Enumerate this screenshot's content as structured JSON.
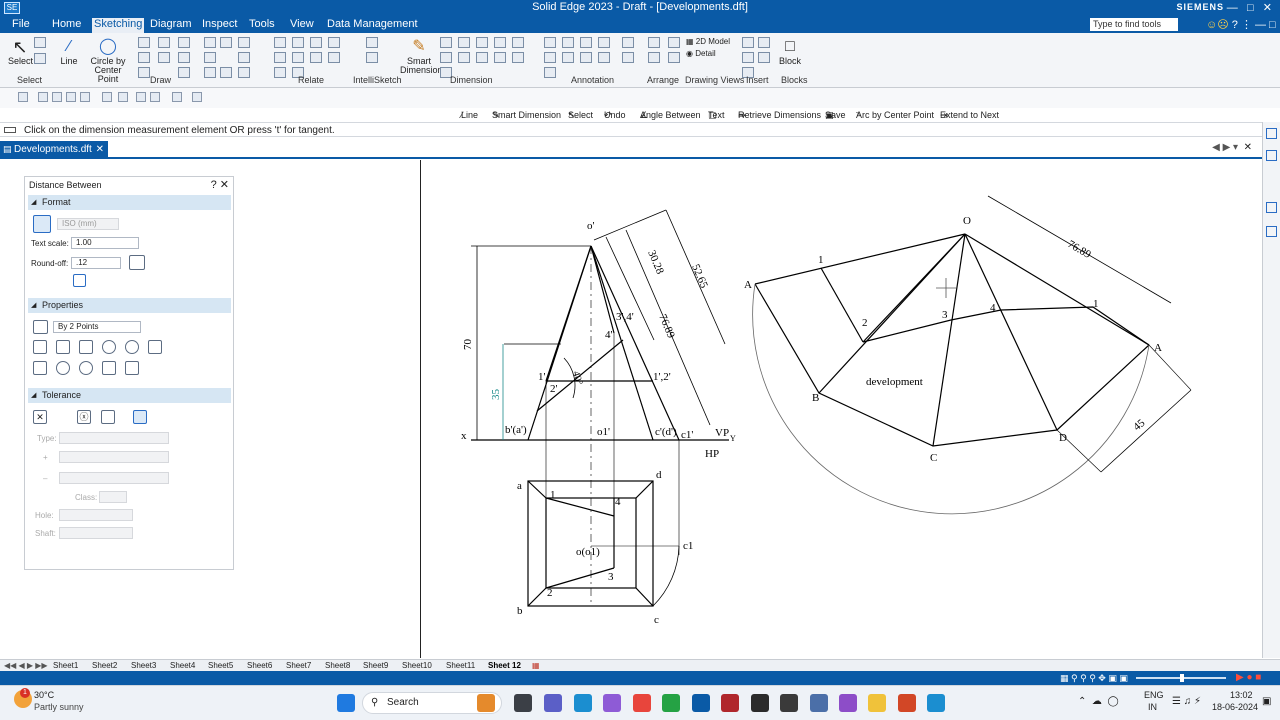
{
  "window": {
    "title": "Solid Edge 2023 - Draft - [Developments.dft]",
    "brand": "SIEMENS",
    "logo": "SE"
  },
  "menu": {
    "items": [
      "File",
      "Home",
      "Sketching",
      "Diagram",
      "Inspect",
      "Tools",
      "View",
      "Data Management"
    ],
    "active": "Sketching",
    "search_placeholder": "Type to find tools"
  },
  "ribbon": {
    "select": "Select",
    "line": "Line",
    "circle": "Circle by Center Point",
    "smart_dimension": "Smart Dimension",
    "model_2d": "2D Model",
    "detail": "Detail",
    "block": "Block",
    "groups": [
      "Select",
      "Draw",
      "Relate",
      "IntelliSketch",
      "Dimension",
      "Annotation",
      "Arrange",
      "Drawing Views",
      "Insert",
      "Blocks"
    ]
  },
  "command_bar": [
    "Line",
    "Smart Dimension",
    "Select",
    "Undo",
    "Angle Between",
    "Text",
    "Retrieve Dimensions",
    "Save",
    "Arc by Center Point",
    "Extend to Next"
  ],
  "prompt": "Click on the dimension measurement element  OR press 't' for tangent.",
  "document_tab": "Developments.dft",
  "panel": {
    "title": "Distance Between",
    "help": "?",
    "format": {
      "heading": "Format",
      "standard": "ISO (mm)",
      "text_scale_label": "Text scale:",
      "text_scale": "1.00",
      "roundoff_label": "Round-off:",
      "roundoff": ".12"
    },
    "properties": {
      "heading": "Properties",
      "mode": "By 2 Points"
    },
    "tolerance": {
      "heading": "Tolerance",
      "type_label": "Type:",
      "plus": "+",
      "minus": "–",
      "class_label": "Class:",
      "hole_label": "Hole:",
      "shaft_label": "Shaft:"
    }
  },
  "drawing": {
    "labels": {
      "o_prime": "o'",
      "dim_70": "70",
      "dim_35": "35",
      "dim_3028": "30.28",
      "dim_5265": "52.65",
      "dim_7689_a": "76.89",
      "p34": "3',4'",
      "p4": "4'",
      "p1": "1'",
      "p2": "2'",
      "angle": "40°",
      "p12": "1',2'",
      "x": "x",
      "ba": "b'(a')",
      "o1": "o1'",
      "cd": "c'(d')",
      "c1p": "c1'",
      "vp": "VP",
      "y": "Y",
      "hp": "HP",
      "a": "a",
      "b": "b",
      "c": "c",
      "d": "d",
      "t1": "1",
      "t2": "2",
      "t3": "3",
      "t4": "4",
      "oo1": "o(o1)",
      "c1": "c1",
      "O": "O",
      "dim_7689": "76.89",
      "A1": "A",
      "A2": "A",
      "B": "B",
      "C": "C",
      "D": "D",
      "d1a": "1",
      "d2": "2",
      "d3": "3",
      "d4": "4",
      "d1b": "1",
      "development": "development",
      "dim_45": "45"
    }
  },
  "sheets": [
    "Sheet1",
    "Sheet2",
    "Sheet3",
    "Sheet4",
    "Sheet5",
    "Sheet6",
    "Sheet7",
    "Sheet8",
    "Sheet9",
    "Sheet10",
    "Sheet11",
    "Sheet 12"
  ],
  "active_sheet": "Sheet 12",
  "taskbar": {
    "temp": "30°C",
    "weather": "Partly sunny",
    "search": "Search",
    "lang1": "ENG",
    "lang2": "IN",
    "time": "13:02",
    "date": "18-06-2024",
    "badge": "1"
  },
  "colors": {
    "accent": "#0a5aa6",
    "dim_teal": "#1a8a8a"
  }
}
